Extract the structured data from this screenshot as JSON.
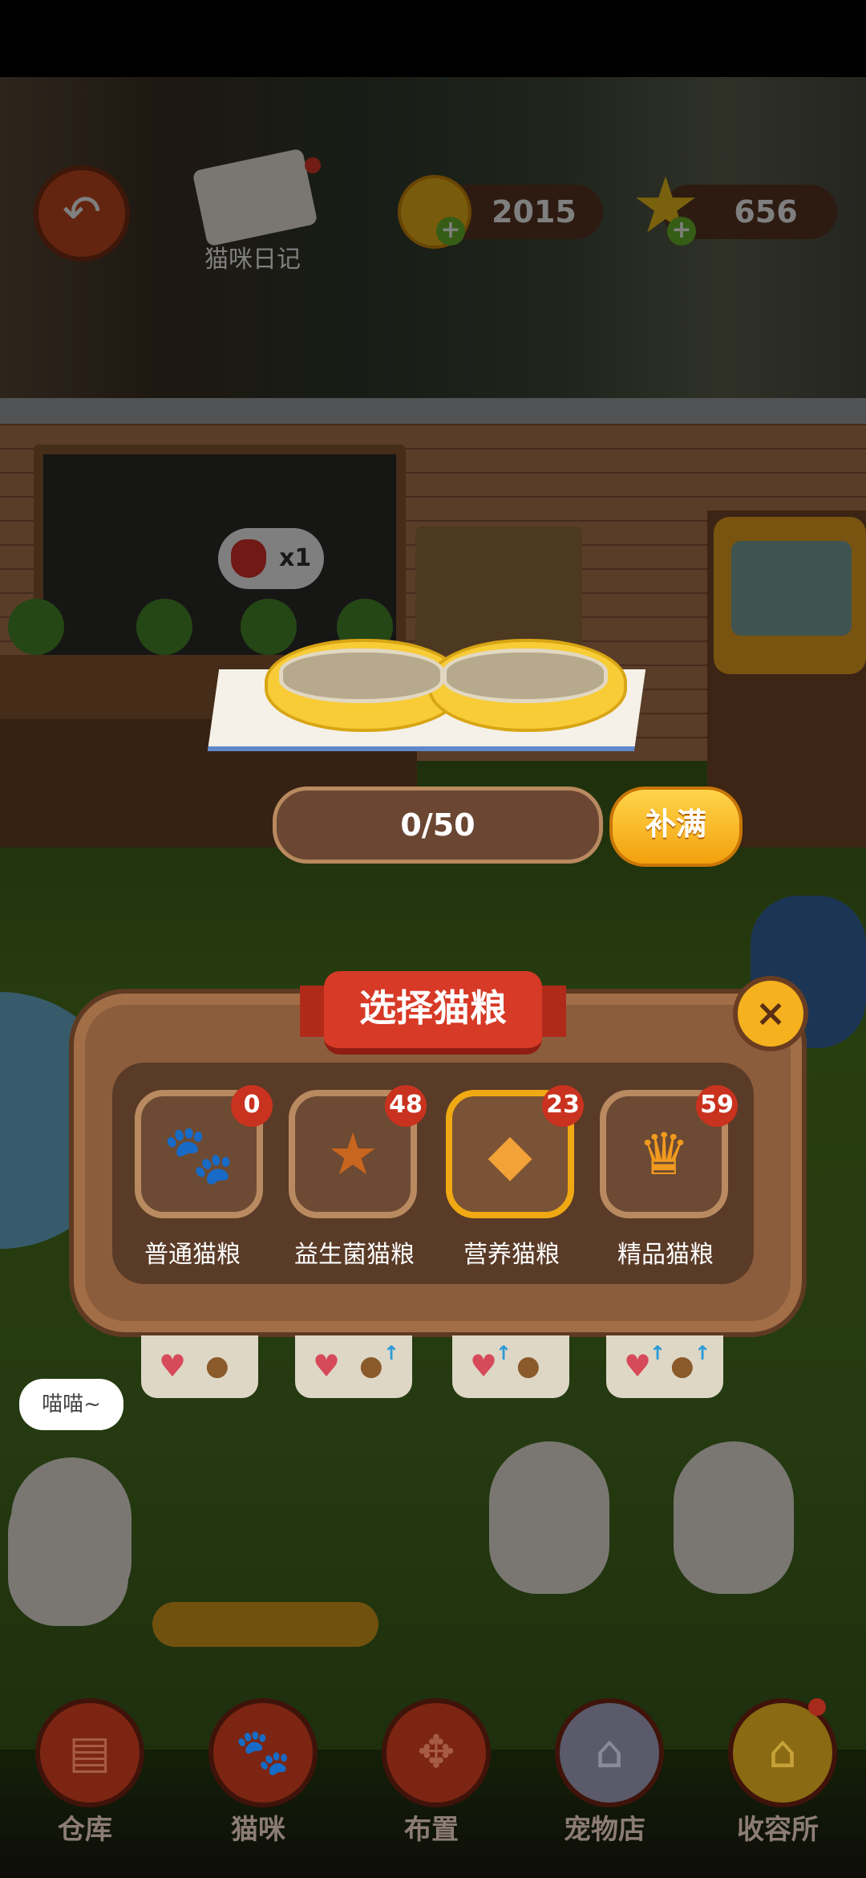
{
  "header": {
    "diary_label": "猫咪日记",
    "coins": "2015",
    "stars": "656"
  },
  "scene": {
    "strawberry_count": "x1"
  },
  "bowl": {
    "progress": "0/50",
    "fill_button": "补满"
  },
  "modal": {
    "title": "选择猫粮",
    "close": "×",
    "foods": [
      {
        "label": "普通猫粮",
        "count": "0",
        "icon": "paw-cookie-icon"
      },
      {
        "label": "益生菌猫粮",
        "count": "48",
        "icon": "star-cookie-icon"
      },
      {
        "label": "营养猫粮",
        "count": "23",
        "icon": "crystal-food-icon",
        "selected": true
      },
      {
        "label": "精品猫粮",
        "count": "59",
        "icon": "crown-food-icon"
      }
    ]
  },
  "cat_bubble": "喵喵~",
  "nav": {
    "items": [
      {
        "label": "仓库",
        "icon": "box-icon"
      },
      {
        "label": "猫咪",
        "icon": "paw-icon"
      },
      {
        "label": "布置",
        "icon": "arrange-icon"
      },
      {
        "label": "宠物店",
        "icon": "shop-icon"
      },
      {
        "label": "收容所",
        "icon": "shelter-icon"
      }
    ]
  },
  "colors": {
    "modal_brown": "#8c5d3c",
    "ribbon_red": "#d73a26",
    "accent_orange": "#f3a10d",
    "badge_red": "#c9321f"
  }
}
